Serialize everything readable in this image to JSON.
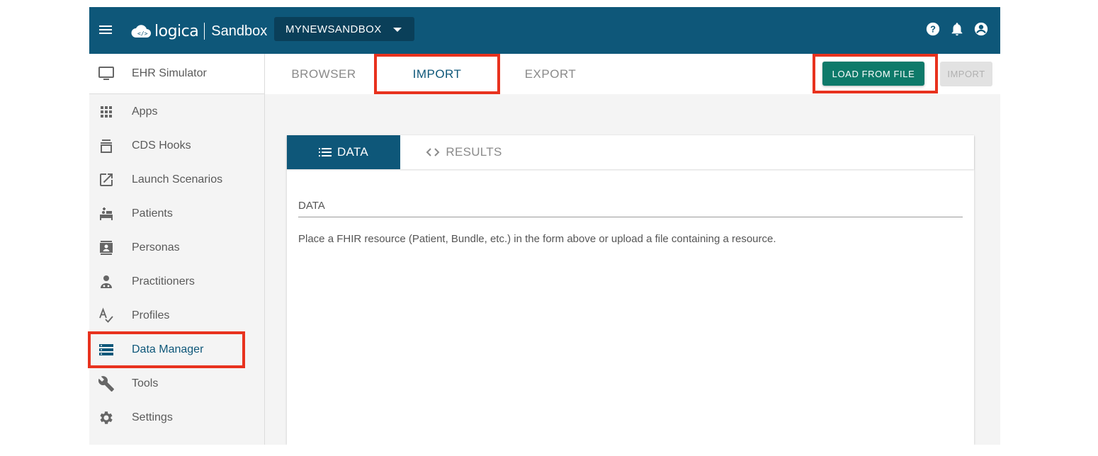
{
  "header": {
    "logo_text": "logica",
    "product": "Sandbox",
    "sandbox_name": "MYNEWSANDBOX",
    "icons": [
      "menu-icon",
      "help-icon",
      "bell-icon",
      "account-icon"
    ]
  },
  "sidebar": {
    "items": [
      {
        "label": "EHR Simulator",
        "icon": "monitor-icon"
      },
      {
        "label": "Apps",
        "icon": "apps-grid-icon"
      },
      {
        "label": "CDS Hooks",
        "icon": "cds-hooks-icon"
      },
      {
        "label": "Launch Scenarios",
        "icon": "launch-icon"
      },
      {
        "label": "Patients",
        "icon": "bed-icon"
      },
      {
        "label": "Personas",
        "icon": "contact-card-icon"
      },
      {
        "label": "Practitioners",
        "icon": "doctor-icon"
      },
      {
        "label": "Profiles",
        "icon": "spellcheck-icon"
      },
      {
        "label": "Data Manager",
        "icon": "storage-icon",
        "active": true
      },
      {
        "label": "Tools",
        "icon": "wrench-icon"
      },
      {
        "label": "Settings",
        "icon": "gear-icon"
      }
    ]
  },
  "main": {
    "tabs": [
      {
        "label": "BROWSER"
      },
      {
        "label": "IMPORT",
        "active": true
      },
      {
        "label": "EXPORT"
      }
    ],
    "load_button": "LOAD FROM FILE",
    "import_button": "IMPORT",
    "card": {
      "tabs": [
        {
          "label": "DATA",
          "icon": "list-icon",
          "active": true
        },
        {
          "label": "RESULTS",
          "icon": "code-icon"
        }
      ],
      "field_label": "DATA",
      "helper_text": "Place a FHIR resource (Patient, Bundle, etc.) in the form above or upload a file containing a resource."
    }
  },
  "colors": {
    "header": "#0e5779",
    "accent_button": "#0e7a6a",
    "highlight": "#e8321e"
  }
}
